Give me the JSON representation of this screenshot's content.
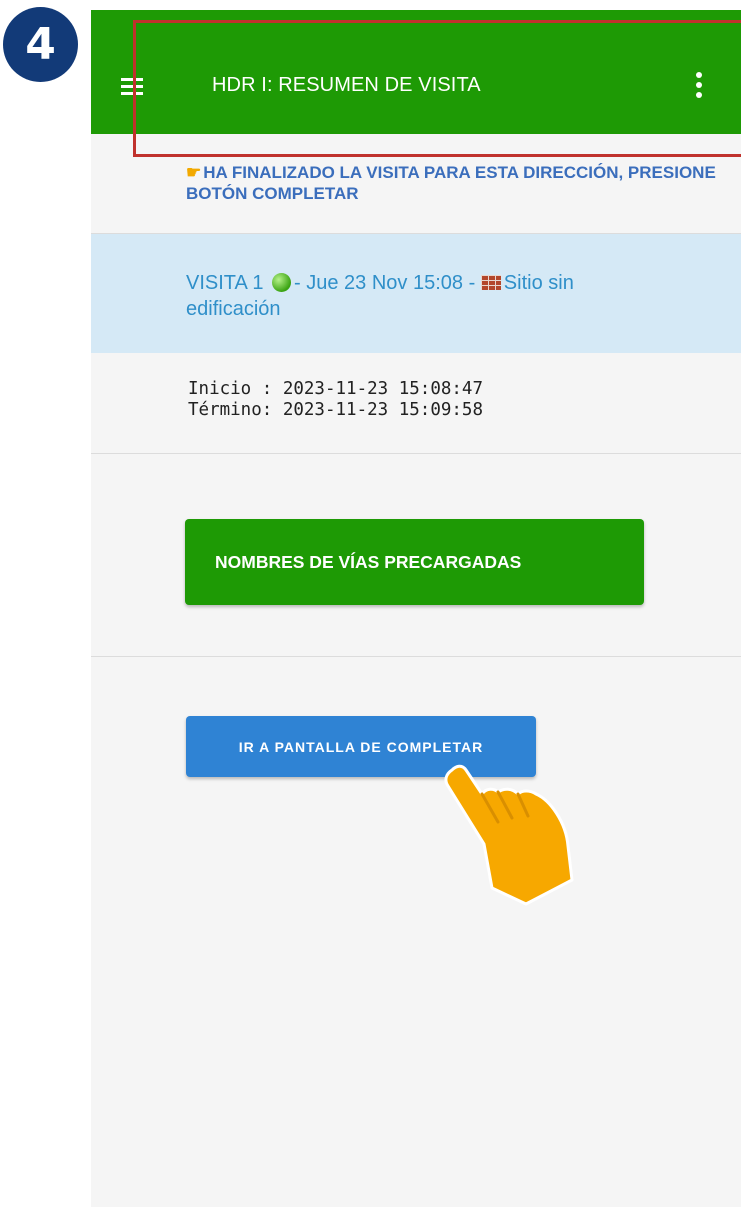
{
  "step": {
    "number": "4"
  },
  "app_bar": {
    "title": "HDR I: RESUMEN DE VISITA",
    "menu_icon": "hamburger-menu-icon",
    "overflow_icon": "more-vertical-icon",
    "color": "#1e9a05"
  },
  "notice": {
    "icon": "pointing-hand-icon",
    "text": "HA FINALIZADO LA VISITA PARA ESTA DIRECCIÓN, PRESIONE BOTÓN COMPLETAR"
  },
  "visit": {
    "label": "VISITA 1",
    "status_icon": "green-dot-icon",
    "date_text": "- Jue 23 Nov 15:08 -",
    "type_icon": "brick-wall-icon",
    "result_line1": "Sitio sin",
    "result_line2": "edificación",
    "background": "#d5e9f6"
  },
  "times": {
    "start": "Inicio : 2023-11-23 15:08:47",
    "end": "Término: 2023-11-23 15:09:58"
  },
  "buttons": {
    "preloaded_streets": "NOMBRES DE VÍAS PRECARGADAS",
    "go_complete": "IR A PANTALLA DE COMPLETAR"
  },
  "colors": {
    "accent_green": "#1e9a05",
    "accent_blue": "#2f83d4",
    "highlight_red": "#c0322d",
    "badge_navy": "#123a78",
    "tutorial_hand": "#f7a800"
  }
}
